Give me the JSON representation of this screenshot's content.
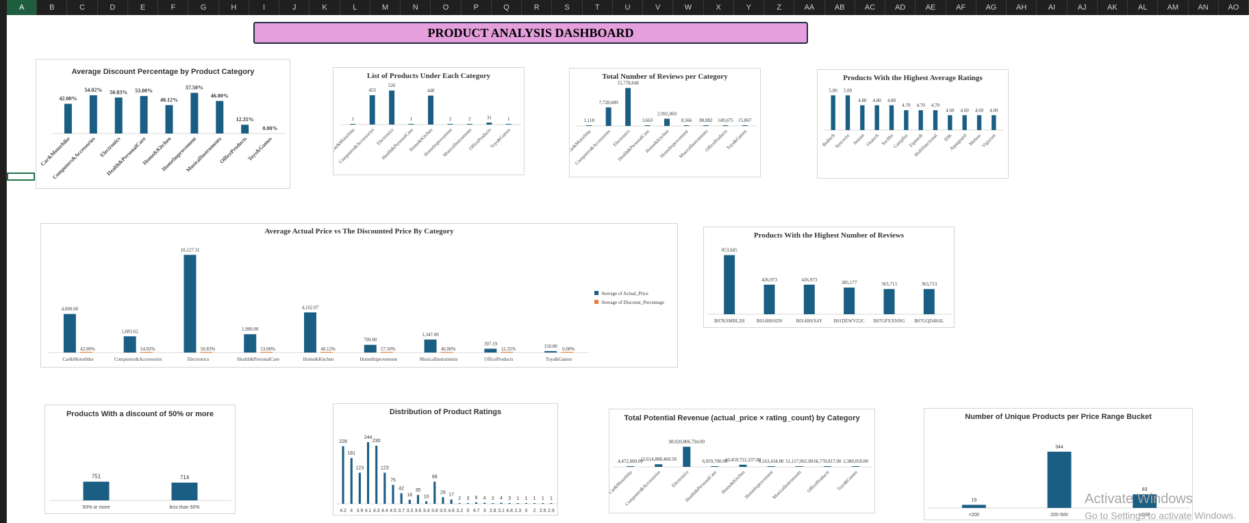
{
  "spreadsheet": {
    "columns": [
      "A",
      "B",
      "C",
      "D",
      "E",
      "F",
      "G",
      "H",
      "I",
      "J",
      "K",
      "L",
      "M",
      "N",
      "O",
      "P",
      "Q",
      "R",
      "S",
      "T",
      "U",
      "V",
      "W",
      "X",
      "Y",
      "Z",
      "AA",
      "AB",
      "AC",
      "AD",
      "AE",
      "AF",
      "AG",
      "AH",
      "AI",
      "AJ",
      "AK",
      "AL",
      "AM",
      "AN",
      "AO"
    ],
    "selected_column": "A"
  },
  "dashboard": {
    "title": "PRODUCT ANALYSIS DASHBOARD"
  },
  "colors": {
    "bar": "#1b5e84",
    "accent": "#ed7d31",
    "title_bg": "#e49fdc"
  },
  "watermark": {
    "line1": "Activate Windows",
    "line2": "Go to Settings to activate Windows."
  },
  "chart_data": [
    {
      "id": "discount",
      "type": "bar",
      "title": "Average Discount Percentage by Product Category",
      "categories": [
        "Car&Motorbike",
        "Computers&Accessories",
        "Electronics",
        "Health&PersonalCare",
        "Home&Kitchen",
        "HomeImprovement",
        "MusicalInstruments",
        "OfficeProducts",
        "Toys&Games"
      ],
      "values": [
        42.0,
        54.02,
        50.83,
        53.0,
        40.12,
        57.5,
        46.0,
        12.35,
        0.0
      ],
      "labels": [
        "42.00%",
        "54.02%",
        "50.83%",
        "53.00%",
        "40.12%",
        "57.50%",
        "46.00%",
        "12.35%",
        "0.00%"
      ],
      "ylim": [
        0,
        60
      ]
    },
    {
      "id": "products_list",
      "type": "bar",
      "title": "List of Products Under Each Category",
      "categories": [
        "Car&Motorbike",
        "Computers&Accessories",
        "Electronics",
        "Health&PersonalCare",
        "Home&Kitchen",
        "HomeImprovement",
        "MusicalInstruments",
        "OfficeProducts",
        "Toys&Games"
      ],
      "values": [
        1,
        453,
        526,
        1,
        448,
        2,
        2,
        31,
        1
      ],
      "labels": [
        "1",
        "453",
        "526",
        "1",
        "448",
        "2",
        "2",
        "31",
        "1"
      ],
      "ylim": [
        0,
        560
      ]
    },
    {
      "id": "reviews",
      "type": "bar",
      "title": "Total Number of Reviews per Category",
      "categories": [
        "Car&Motorbike",
        "Computers&Accessories",
        "Electronics",
        "Health&PersonalCare",
        "Home&Kitchen",
        "HomeImprovement",
        "MusicalInstruments",
        "OfficeProducts",
        "Toys&Games"
      ],
      "values": [
        1118,
        7728689,
        15778848,
        3663,
        2991069,
        8566,
        88882,
        149675,
        15867
      ],
      "labels": [
        "1,118",
        "7,728,689",
        "15,778,848",
        "3,663",
        "2,991,069",
        "8,566",
        "88,882",
        "149,675",
        "15,867"
      ],
      "ylim": [
        0,
        16500000
      ]
    },
    {
      "id": "top_ratings",
      "type": "bar",
      "title": "Products With the Highest Average Ratings",
      "categories": [
        "Redtech",
        "Syncwire",
        "Instant",
        "Oratech",
        "Swiffer",
        "Campfire",
        "Fipmesh",
        "Multifunctional",
        "IDK",
        "Aquaguard",
        "Mebow",
        "Vigsyum"
      ],
      "values": [
        5.0,
        5.0,
        4.8,
        4.8,
        4.8,
        4.7,
        4.7,
        4.7,
        4.6,
        4.6,
        4.6,
        4.6
      ],
      "labels": [
        "5.00",
        "5.00",
        "4.80",
        "4.80",
        "4.80",
        "4.70",
        "4.70",
        "4.70",
        "4.60",
        "4.60",
        "4.60",
        "4.60"
      ],
      "ylim": [
        4.3,
        5.1
      ]
    },
    {
      "id": "price_compare",
      "type": "bar",
      "title": "Average Actual Price vs The Discounted Price By Category",
      "categories": [
        "Car&Motorbike",
        "Computers&Accessories",
        "Electronics",
        "Health&PersonalCare",
        "Home&Kitchen",
        "HomeImprovement",
        "MusicalInstruments",
        "OfficeProducts",
        "Toys&Games"
      ],
      "series": [
        {
          "name": "Average of Actual_Price",
          "values": [
            4000.0,
            1683.62,
            10127.31,
            1900.0,
            4162.07,
            799.0,
            1347.0,
            397.19,
            150.0
          ],
          "labels": [
            "4,000.00",
            "1,683.62",
            "10,127.31",
            "1,900.00",
            "4,162.07",
            "799.00",
            "1,347.00",
            "397.19",
            "150.00"
          ]
        },
        {
          "name": "Average of Discount_Percentage",
          "values": [
            42.0,
            54.02,
            50.83,
            53.0,
            40.12,
            57.5,
            46.0,
            12.35,
            0.0
          ],
          "labels": [
            "42.00%",
            "54.02%",
            "50.83%",
            "53.00%",
            "40.12%",
            "57.50%",
            "46.00%",
            "12.35%",
            "0.00%"
          ]
        }
      ],
      "ylim": [
        0,
        10500
      ],
      "legend": "right"
    },
    {
      "id": "top_reviews",
      "type": "bar",
      "title": "Products With the Highest Number of Reviews",
      "categories": [
        "B07KSMBL2H",
        "B014I8SSD0",
        "B014I8SX4Y",
        "B01DEWVZ2C",
        "B07GPXXNNG",
        "B07GQD4K6L"
      ],
      "values": [
        853945,
        426973,
        426973,
        385177,
        363713,
        363713
      ],
      "labels": [
        "853,945",
        "426,973",
        "426,973",
        "385,177",
        "363,713",
        "363,713"
      ],
      "ylim": [
        0,
        900000
      ]
    },
    {
      "id": "discount50",
      "type": "bar",
      "title": "Products With a discount of 50% or more",
      "categories": [
        "50% or more",
        "less than 50%"
      ],
      "values": [
        751,
        714
      ],
      "labels": [
        "751",
        "714"
      ],
      "ylim": [
        0,
        2800
      ]
    },
    {
      "id": "rating_dist",
      "type": "bar",
      "title": "Distribution of Product Ratings",
      "categories": [
        "4.2",
        "4",
        "3.9",
        "4.1",
        "4.3",
        "4.4",
        "4.5",
        "3.7",
        "3.3",
        "3.6",
        "3.4",
        "3.8",
        "3.5",
        "4.6",
        "3.2",
        "5",
        "4.7",
        "3",
        "2.8",
        "3.1",
        "4.8",
        "2.3",
        "0",
        "2",
        "2.6",
        "2.9"
      ],
      "values": [
        228,
        181,
        123,
        244,
        230,
        123,
        75,
        42,
        16,
        35,
        10,
        88,
        26,
        17,
        2,
        3,
        6,
        4,
        2,
        4,
        3,
        1,
        1,
        1,
        1,
        1
      ],
      "labels": [
        "228",
        "181",
        "123",
        "244",
        "230",
        "123",
        "75",
        "42",
        "16",
        "35",
        "10",
        "88",
        "26",
        "17",
        "2",
        "3",
        "6",
        "4",
        "2",
        "4",
        "3",
        "1",
        "1",
        "1",
        "1",
        "1"
      ],
      "ylim": [
        0,
        260
      ]
    },
    {
      "id": "revenue",
      "type": "bar",
      "title": "Total Potential Revenue (actual_price × rating_count) by Category",
      "categories": [
        "Car&Motorbike",
        "Computers&Accessories",
        "Electronics",
        "Health&PersonalCare",
        "Home&Kitchen",
        "HomeImprovement",
        "MusicalInstruments",
        "OfficeProducts",
        "Toys&Games"
      ],
      "values": [
        4472000,
        12614808460.58,
        98020806794,
        6959700,
        10459722337,
        6163434.0,
        51117062.0,
        66778817.0,
        2380050.0
      ],
      "labels": [
        "4,472,000.00",
        "12,614,808,460.58",
        "98,020,806,794.00",
        "6,959,700.00",
        "10,459,722,337.00",
        "6,163,434.00",
        "51,117,062.00",
        "66,778,817.00",
        "2,380,050.00"
      ],
      "ylim": [
        0,
        100000000000
      ]
    },
    {
      "id": "price_bucket",
      "type": "bar",
      "title": "Number of Unique Products per Price Range Bucket",
      "categories": [
        "<200",
        "200-500",
        ">500"
      ],
      "values": [
        19,
        344,
        83
      ],
      "labels": [
        "19",
        "344",
        "83"
      ],
      "ylim": [
        0,
        360
      ]
    }
  ]
}
